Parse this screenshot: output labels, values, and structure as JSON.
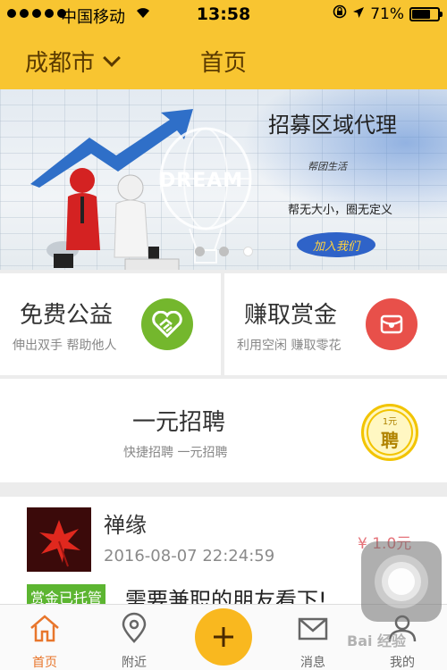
{
  "status_bar": {
    "carrier": "中国移动",
    "time": "13:58",
    "battery": "71%",
    "battery_level": 0.71
  },
  "nav": {
    "city": "成都市",
    "title": "首页"
  },
  "banner": {
    "title": "招募区域代理",
    "brand": "帮团生活",
    "slogan": "帮无大小，圈无定义",
    "join_label": "加入我们",
    "balloon_text": "DREAM",
    "page_count": 3,
    "active_page": 3
  },
  "cards": {
    "charity": {
      "title": "免费公益",
      "subtitle": "伸出双手 帮助他人"
    },
    "bounty": {
      "title": "赚取赏金",
      "subtitle": "利用空闲 赚取零花"
    },
    "recruit": {
      "title": "一元招聘",
      "subtitle": "快捷招聘 一元招聘",
      "seal_top": "1元",
      "seal_main": "聘"
    }
  },
  "feed_item": {
    "name": "禅缘",
    "time": "2016-08-07 22:24:59",
    "price": "¥ 1.0元",
    "tag": "赏金已托管",
    "desc": "需要兼职的朋友看下!"
  },
  "tabs": [
    {
      "label": "首页",
      "icon": "home-icon",
      "active": true
    },
    {
      "label": "附近",
      "icon": "location-pin-icon",
      "active": false
    },
    {
      "label": "",
      "icon": "plus-icon",
      "active": false
    },
    {
      "label": "消息",
      "icon": "mail-icon",
      "active": false
    },
    {
      "label": "我的",
      "icon": "user-icon",
      "active": false
    }
  ],
  "watermark": "Bai 经验",
  "colors": {
    "header": "#f8c531",
    "accent": "#e8762c",
    "green": "#74b72d",
    "red": "#e8504a",
    "price": "#e5737a",
    "tag": "#5cb531"
  }
}
